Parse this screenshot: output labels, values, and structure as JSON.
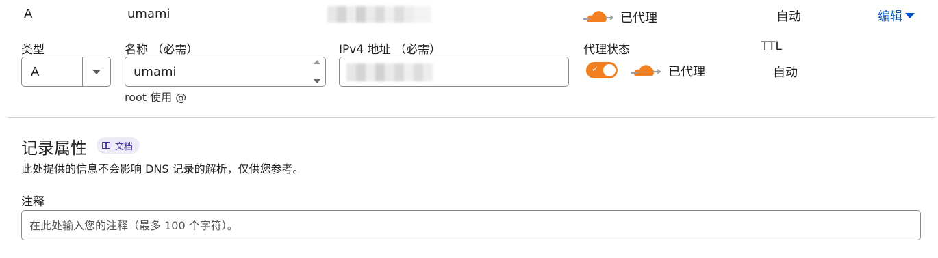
{
  "record": {
    "type": "A",
    "name": "umami",
    "proxy_status": "已代理",
    "ttl": "自动",
    "edit_label": "编辑"
  },
  "form": {
    "type_label": "类型",
    "name_label": "名称 （必需）",
    "ipv4_label": "IPv4 地址 （必需）",
    "proxy_label": "代理状态",
    "ttl_label": "TTL",
    "type_value": "A",
    "name_value": "umami",
    "name_hint": "root 使用 @",
    "proxy_status": "已代理",
    "proxy_enabled": true,
    "ttl_value": "自动"
  },
  "attributes": {
    "title": "记录属性",
    "doc_badge": "文档",
    "description": "此处提供的信息不会影响 DNS 记录的解析，仅供您参考。",
    "comment_label": "注释",
    "comment_placeholder": "在此处输入您的注释（最多 100 个字符）。"
  },
  "colors": {
    "accent": "#f38020",
    "link": "#0051c3"
  },
  "icons": [
    "cloud-icon",
    "chevron-down-icon",
    "book-icon",
    "check-icon"
  ]
}
